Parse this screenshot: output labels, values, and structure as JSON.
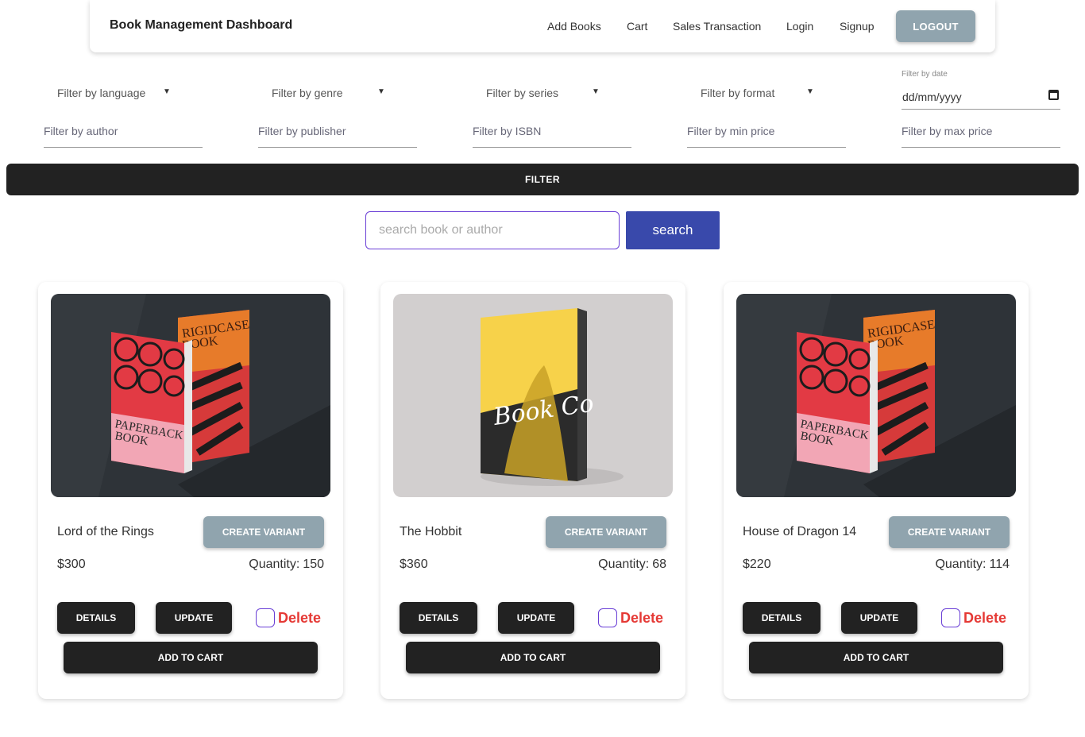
{
  "header": {
    "title": "Book Management Dashboard",
    "nav": [
      "Add Books",
      "Cart",
      "Sales Transaction",
      "Login",
      "Signup"
    ],
    "logout": "LOGOUT"
  },
  "filters": {
    "selects": [
      "Filter by language",
      "Filter by genre",
      "Filter by series",
      "Filter by format"
    ],
    "date_label": "Filter by date",
    "date_value": "dd/mm/yyyy",
    "text_fields": [
      "Filter by author",
      "Filter by publisher",
      "Filter by ISBN",
      "Filter by min price",
      "Filter by max price"
    ],
    "filter_button": "FILTER"
  },
  "search": {
    "placeholder": "search book or author",
    "button": "search"
  },
  "card_labels": {
    "create_variant": "CREATE VARIANT",
    "quantity": "Quantity:",
    "details": "DETAILS",
    "update": "UPDATE",
    "delete": "Delete",
    "add_to_cart": "ADD TO CART"
  },
  "books": [
    {
      "title": "Lord of the Rings",
      "price": "$300",
      "quantity": "150",
      "image": "paperback-rigidcase-mockup"
    },
    {
      "title": "The Hobbit",
      "price": "$360",
      "quantity": "68",
      "image": "yellow-book-cover-mockup"
    },
    {
      "title": "House of Dragon 14",
      "price": "$220",
      "quantity": "114",
      "image": "paperback-rigidcase-mockup"
    }
  ],
  "colors": {
    "logout": "#90a4ae",
    "dark_button": "#222222",
    "search_button": "#3949ab",
    "delete": "#e53935",
    "checkbox_border": "#6a3fd6"
  }
}
